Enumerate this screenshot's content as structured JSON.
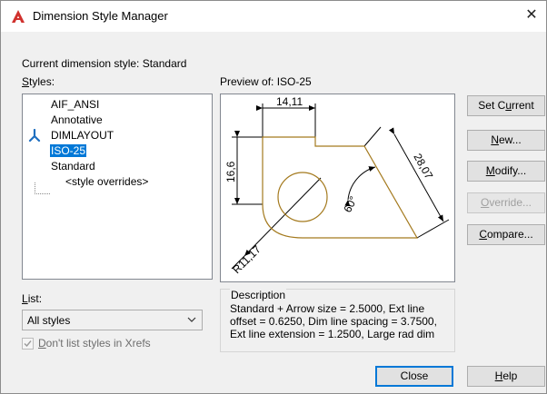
{
  "window": {
    "title": "Dimension Style Manager",
    "close_glyph": "✕",
    "brand_color": "#d0312d"
  },
  "current_style": {
    "label": "Current dimension style: Standard"
  },
  "styles": {
    "label_prefix": "",
    "label_underlined": "S",
    "label_rest": "tyles:",
    "items": [
      {
        "label": "AIF_ANSI",
        "selected": false,
        "annotative": false
      },
      {
        "label": "Annotative",
        "selected": false,
        "annotative": true
      },
      {
        "label": "DIMLAYOUT",
        "selected": false,
        "annotative": false
      },
      {
        "label": "ISO-25",
        "selected": true,
        "annotative": false
      },
      {
        "label": "Standard",
        "selected": false,
        "annotative": false
      },
      {
        "label": "<style overrides>",
        "selected": false,
        "annotative": false
      }
    ]
  },
  "list": {
    "label_underlined": "L",
    "label_rest": "ist:",
    "selected": "All styles",
    "icon": "chevron-down-icon"
  },
  "xrefs": {
    "checked": true,
    "label_underlined": "D",
    "label_rest": "on't list styles in Xrefs"
  },
  "preview": {
    "label": "Preview of: ISO-25",
    "drawing_color": "#a47a1e",
    "dims": {
      "top": "14,11",
      "left": "16,6",
      "right": "28,07",
      "angle": "60°",
      "radius": "R11,17"
    }
  },
  "description": {
    "label": "Description",
    "text": "Standard + Arrow size = 2.5000, Ext line offset = 0.6250, Dim line spacing = 3.7500, Ext line extension = 1.2500, Large rad dim"
  },
  "buttons": {
    "set_current": {
      "pre": "Set C",
      "u": "u",
      "post": "rrent"
    },
    "new": {
      "pre": "",
      "u": "N",
      "post": "ew..."
    },
    "modify": {
      "pre": "",
      "u": "M",
      "post": "odify..."
    },
    "override": {
      "pre": "",
      "u": "O",
      "post": "verride..."
    },
    "compare": {
      "pre": "",
      "u": "C",
      "post": "ompare..."
    },
    "close": {
      "pre": "Close",
      "u": "",
      "post": ""
    },
    "help": {
      "pre": "",
      "u": "H",
      "post": "elp"
    }
  },
  "colors": {
    "selection": "#0078d7",
    "annotative_icon": "#1f6fc0"
  }
}
